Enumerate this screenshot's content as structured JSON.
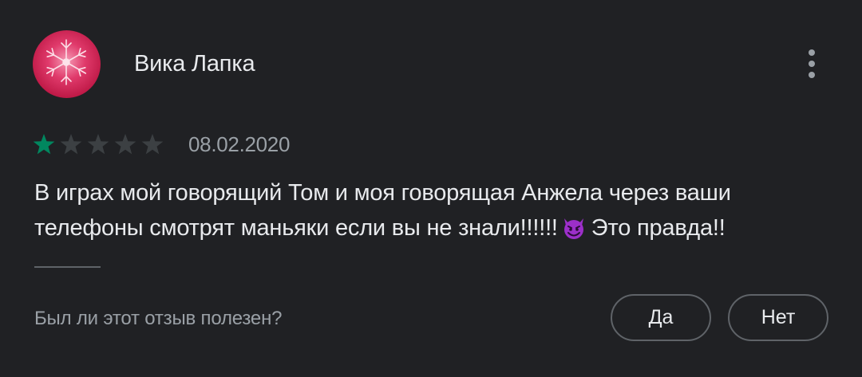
{
  "review": {
    "author": "Вика Лапка",
    "avatar_icon": "snowflake-avatar",
    "rating": 1,
    "rating_max": 5,
    "date": "08.02.2020",
    "text_line1": "В играх мой говорящий Том и моя говорящая Анжела через ваши",
    "text_line2_before_emoji": "телефоны смотрят маньяки если вы не знали!!!!!!",
    "emoji": "smiling-devil-emoji",
    "text_line2_after_emoji": "Это правда!!",
    "more_icon": "more-vert-icon"
  },
  "feedback": {
    "question": "Был ли этот отзыв полезен?",
    "yes_label": "Да",
    "no_label": "Нет"
  },
  "colors": {
    "background": "#202124",
    "primary_text": "#e8eaed",
    "secondary_text": "#9aa0a6",
    "star_filled": "#01875f",
    "star_empty": "#3c4043",
    "outline": "#5f6368"
  }
}
